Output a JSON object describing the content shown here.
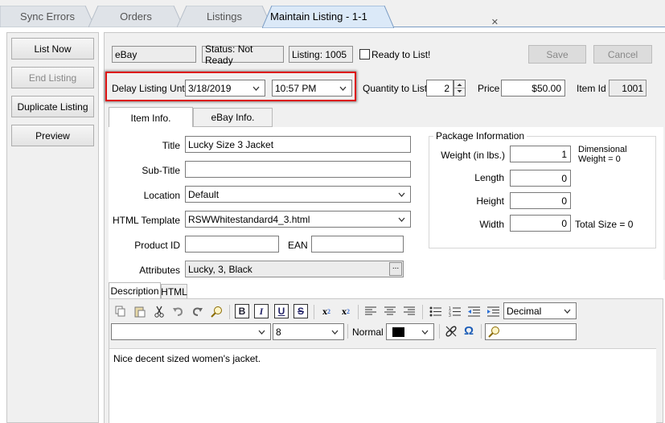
{
  "tabs": [
    {
      "label": "Sync Errors",
      "active": false
    },
    {
      "label": "Orders",
      "active": false
    },
    {
      "label": "Listings",
      "active": false
    },
    {
      "label": "Maintain Listing - 1-1",
      "active": true
    }
  ],
  "left_buttons": {
    "list_now": "List Now",
    "end_listing": "End Listing",
    "duplicate_listing": "Duplicate Listing",
    "preview": "Preview"
  },
  "header": {
    "channel": "eBay",
    "status": "Status: Not Ready",
    "listing": "Listing: 1005",
    "ready_label": "Ready to List!",
    "save": "Save",
    "cancel": "Cancel"
  },
  "delay": {
    "label": "Delay Listing Until",
    "date": "3/18/2019",
    "time": "10:57 PM"
  },
  "quantity": {
    "label": "Quantity to List",
    "value": "2"
  },
  "price": {
    "label": "Price",
    "value": "$50.00"
  },
  "item_id": {
    "label": "Item Id",
    "value": "1001"
  },
  "subtabs": {
    "item_info": "Item Info.",
    "ebay_info": "eBay Info."
  },
  "fields": {
    "title_label": "Title",
    "title_value": "Lucky Size 3 Jacket",
    "subtitle_label": "Sub-Title",
    "subtitle_value": "",
    "location_label": "Location",
    "location_value": "Default",
    "template_label": "HTML Template",
    "template_value": "RSWWhitestandard4_3.html",
    "product_id_label": "Product ID",
    "product_id_value": "",
    "ean_label": "EAN",
    "ean_value": "",
    "attributes_label": "Attributes",
    "attributes_value": "Lucky, 3, Black",
    "ellipsis": "..."
  },
  "package": {
    "title": "Package Information",
    "weight_label": "Weight (in lbs.)",
    "weight_value": "1",
    "dimensional": "Dimensional",
    "dimensional_weight": "Weight = 0",
    "length_label": "Length",
    "length_value": "0",
    "height_label": "Height",
    "height_value": "0",
    "width_label": "Width",
    "width_value": "0",
    "total_size": "Total Size = 0"
  },
  "desc_tabs": {
    "description": "Description",
    "html": "HTML"
  },
  "editor": {
    "list_style": "Decimal",
    "font_family": "",
    "font_size": "8",
    "format": "Normal",
    "color": "#000000",
    "body_text": "Nice decent sized women's jacket."
  },
  "icons": {
    "copy": "copy-icon",
    "paste": "paste-icon",
    "cut": "cut-icon",
    "undo": "undo-icon",
    "redo": "redo-icon",
    "find": "find-icon",
    "bold": "bold-icon",
    "italic": "italic-icon",
    "underline": "underline-icon",
    "strike": "strikethrough-icon",
    "subscript": "subscript-icon",
    "superscript": "superscript-icon",
    "align_left": "align-left-icon",
    "align_center": "align-center-icon",
    "align_right": "align-right-icon",
    "bullets": "bullet-list-icon",
    "numbers": "numbered-list-icon",
    "outdent": "outdent-icon",
    "indent": "indent-icon",
    "link": "link-icon",
    "omega": "special-char-icon"
  }
}
